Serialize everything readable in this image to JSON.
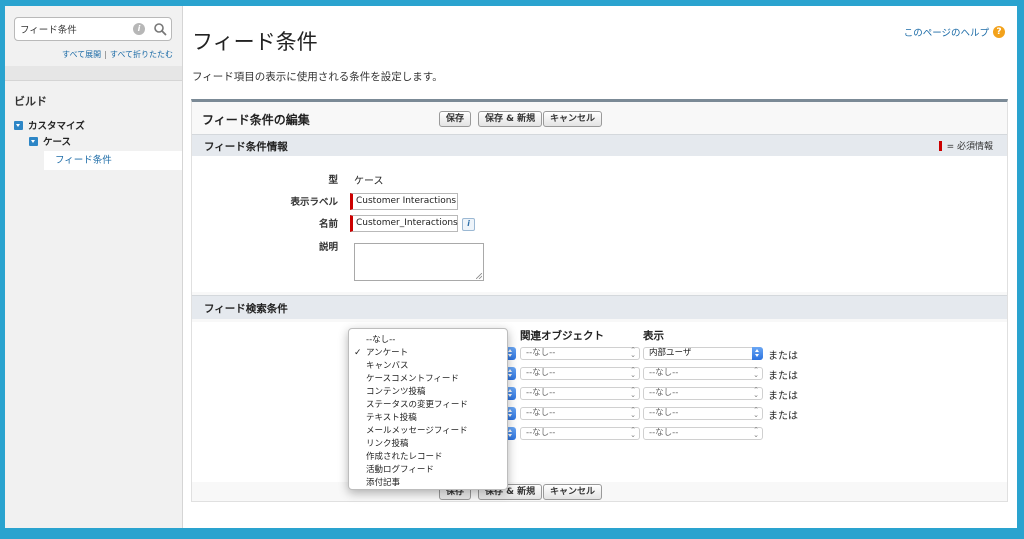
{
  "sidebar": {
    "search_value": "フィード条件",
    "expand_all": "すべて展開",
    "separator": "|",
    "collapse_all": "すべて折りたたむ",
    "section": "ビルド",
    "tree_customize": "カスタマイズ",
    "tree_case": "ケース",
    "tree_feed_filters": "フィード条件"
  },
  "header": {
    "title": "フィード条件",
    "help_link": "このページのヘルプ",
    "description": "フィード項目の表示に使用される条件を設定します。"
  },
  "panel": {
    "title": "フィード条件の編集",
    "save": "保存",
    "save_new": "保存 & 新規",
    "cancel": "キャンセル"
  },
  "info_section": {
    "title": "フィード条件情報",
    "required_legend": "= 必須情報",
    "type_label": "型",
    "type_value": "ケース",
    "display_label": "表示ラベル",
    "display_value": "Customer Interactions",
    "name_label": "名前",
    "name_value": "Customer_Interactions",
    "description_label": "説明"
  },
  "criteria_section": {
    "title": "フィード検索条件",
    "col_related": "関連オブジェクト",
    "col_visibility": "表示",
    "none_option": "--なし--",
    "internal_user": "内部ユーザ",
    "or_label": "または"
  },
  "dropdown": {
    "selected": "アンケート",
    "items": [
      "--なし--",
      "アンケート",
      "キャンバス",
      "ケースコメントフィード",
      "コンテンツ投稿",
      "ステータスの変更フィード",
      "テキスト投稿",
      "メールメッセージフィード",
      "リンク投稿",
      "作成されたレコード",
      "活動ログフィード",
      "添付記事"
    ]
  },
  "colors": {
    "accent": "#2d86c6",
    "required": "#cc0000",
    "link": "#1a6aa6",
    "help": "#f3a21b",
    "background": "#2aa3cf"
  }
}
